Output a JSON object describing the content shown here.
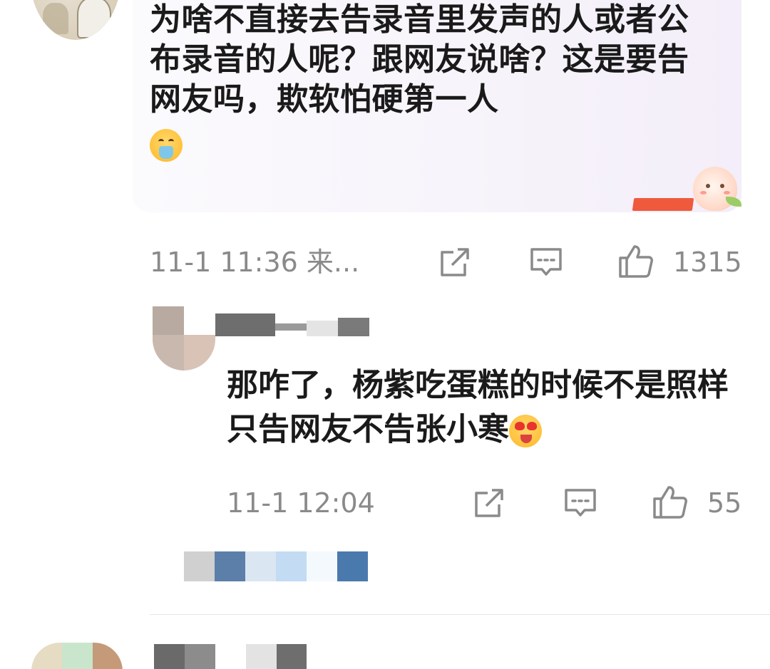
{
  "comment": {
    "text": "为啥不直接去告录音里发声的人或者公布录音的人呢？跟网友说啥？这是要告网友吗，欺软怕硬第一人",
    "emoji_icon": "mask-vomit-emoji-icon",
    "time": "11-1 11:36 来...",
    "like_count": "1315"
  },
  "reply": {
    "text": "那咋了，杨紫吃蛋糕的时候不是照样只告网友不告张小寒",
    "emoji_icon": "heart-eyes-tongue-emoji-icon",
    "time": "11-1 12:04",
    "like_count": "55"
  },
  "colors": {
    "bubble_tint": "#f6f2fa",
    "meta_gray": "#8a8a8a",
    "text_dark": "#1a1a1a"
  },
  "icons": {
    "share": "share-icon",
    "comment": "comment-icon",
    "like": "thumbs-up-icon"
  }
}
